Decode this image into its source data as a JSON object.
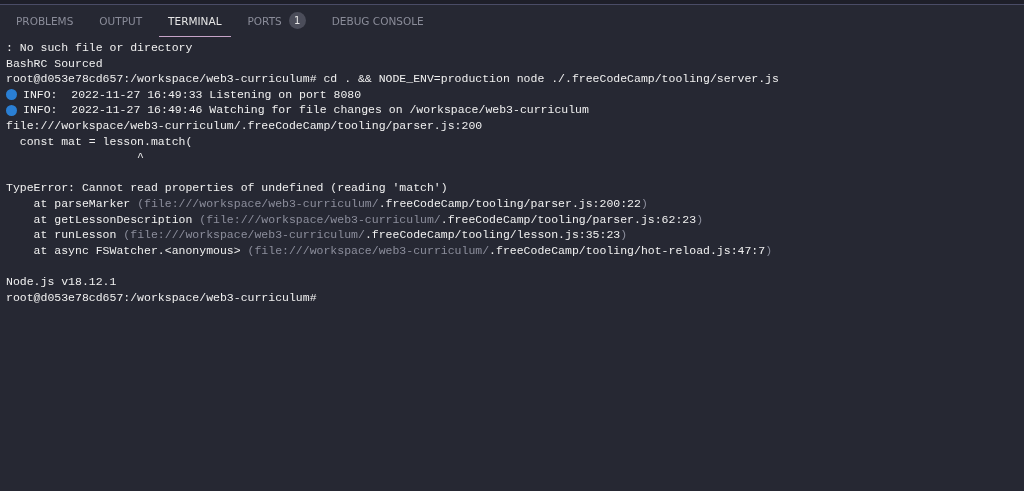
{
  "tabs": [
    {
      "label": "PROBLEMS",
      "selected": false
    },
    {
      "label": "OUTPUT",
      "selected": false
    },
    {
      "label": "TERMINAL",
      "selected": true
    },
    {
      "label": "PORTS",
      "selected": false,
      "badge": "1"
    },
    {
      "label": "DEBUG CONSOLE",
      "selected": false
    }
  ],
  "terminal": {
    "lines": [
      {
        "kind": "text",
        "segments": [
          {
            "text": ": No such file or directory",
            "dim": false
          }
        ]
      },
      {
        "kind": "text",
        "segments": [
          {
            "text": "BashRC Sourced",
            "dim": false
          }
        ]
      },
      {
        "kind": "text",
        "segments": [
          {
            "text": "root@d053e78cd657:/workspace/web3-curriculum# cd . && NODE_ENV=production node ./.freeCodeCamp/tooling/server.js",
            "dim": false
          }
        ]
      },
      {
        "kind": "info",
        "segments": [
          {
            "text": "INFO:  2022-11-27 16:49:33 Listening on port 8080",
            "dim": false
          }
        ]
      },
      {
        "kind": "info",
        "segments": [
          {
            "text": "INFO:  2022-11-27 16:49:46 Watching for file changes on /workspace/web3-curriculum",
            "dim": false
          }
        ]
      },
      {
        "kind": "text",
        "segments": [
          {
            "text": "file:///workspace/web3-curriculum/.freeCodeCamp/tooling/parser.js:200",
            "dim": false
          }
        ]
      },
      {
        "kind": "text",
        "segments": [
          {
            "text": "  const mat = lesson.match(",
            "dim": false
          }
        ]
      },
      {
        "kind": "text",
        "segments": [
          {
            "text": "                   ^",
            "dim": false
          }
        ]
      },
      {
        "kind": "blank"
      },
      {
        "kind": "text",
        "segments": [
          {
            "text": "TypeError: Cannot read properties of undefined (reading 'match')",
            "dim": false
          }
        ]
      },
      {
        "kind": "text",
        "segments": [
          {
            "text": "    at parseMarker ",
            "dim": false
          },
          {
            "text": "(file:///workspace/web3-curriculum/",
            "dim": true
          },
          {
            "text": ".freeCodeCamp/tooling/parser.js:200:22",
            "dim": false
          },
          {
            "text": ")",
            "dim": true
          }
        ]
      },
      {
        "kind": "text",
        "segments": [
          {
            "text": "    at getLessonDescription ",
            "dim": false
          },
          {
            "text": "(file:///workspace/web3-curriculum/",
            "dim": true
          },
          {
            "text": ".freeCodeCamp/tooling/parser.js:62:23",
            "dim": false
          },
          {
            "text": ")",
            "dim": true
          }
        ]
      },
      {
        "kind": "text",
        "segments": [
          {
            "text": "    at runLesson ",
            "dim": false
          },
          {
            "text": "(file:///workspace/web3-curriculum/",
            "dim": true
          },
          {
            "text": ".freeCodeCamp/tooling/lesson.js:35:23",
            "dim": false
          },
          {
            "text": ")",
            "dim": true
          }
        ]
      },
      {
        "kind": "text",
        "segments": [
          {
            "text": "    at async FSWatcher.<anonymous> ",
            "dim": false
          },
          {
            "text": "(file:///workspace/web3-curriculum/",
            "dim": true
          },
          {
            "text": ".freeCodeCamp/tooling/hot-reload.js:47:7",
            "dim": false
          },
          {
            "text": ")",
            "dim": true
          }
        ]
      },
      {
        "kind": "blank"
      },
      {
        "kind": "text",
        "segments": [
          {
            "text": "Node.js v18.12.1",
            "dim": false
          }
        ]
      },
      {
        "kind": "text",
        "segments": [
          {
            "text": "root@d053e78cd657:/workspace/web3-curriculum#",
            "dim": false
          }
        ]
      }
    ]
  }
}
